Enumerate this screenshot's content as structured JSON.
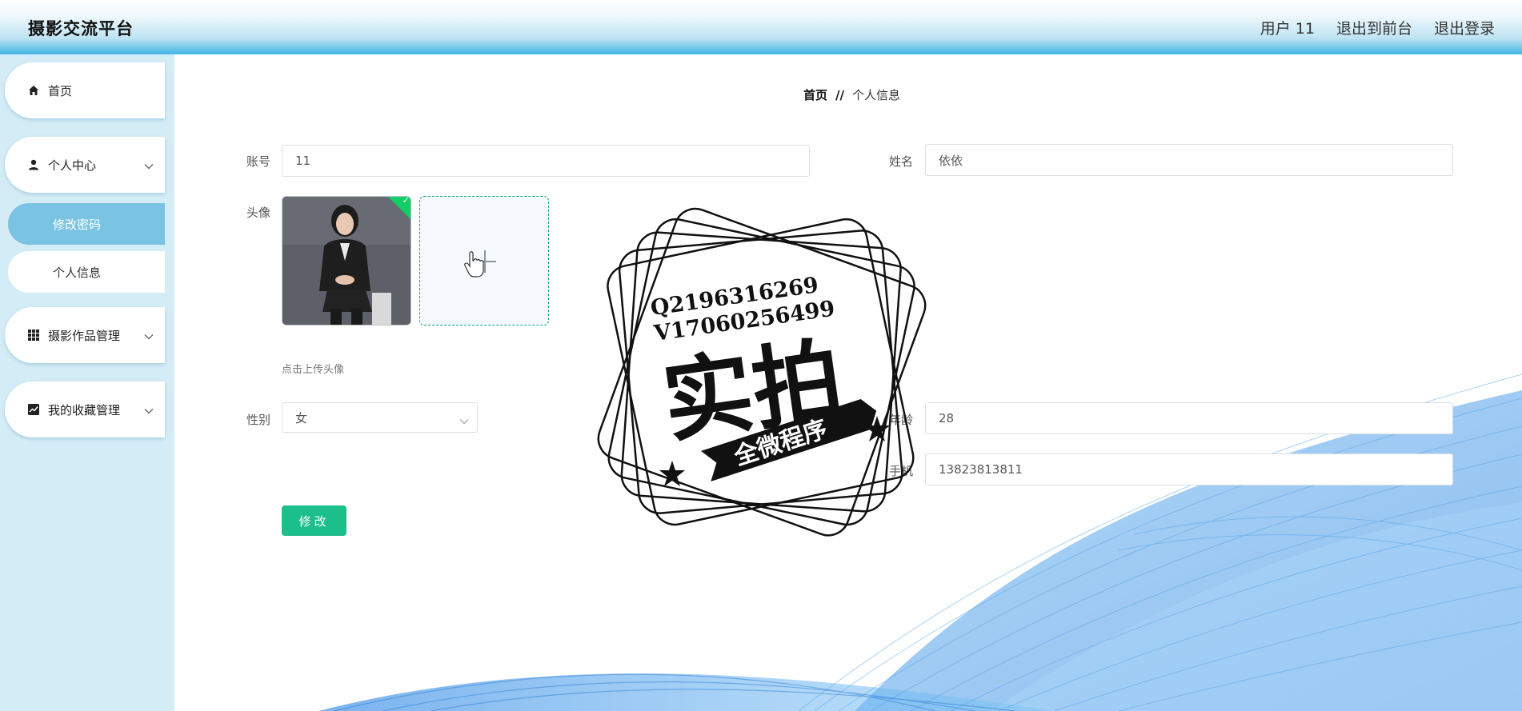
{
  "header": {
    "app_title": "摄影交流平台",
    "user_label": "用户 11",
    "back_to_front": "退出到前台",
    "logout": "退出登录"
  },
  "sidebar": {
    "items": [
      {
        "label": "首页",
        "icon": "home-icon"
      },
      {
        "label": "个人中心",
        "icon": "user-icon"
      },
      {
        "label": "修改密码"
      },
      {
        "label": "个人信息"
      },
      {
        "label": "摄影作品管理",
        "icon": "grid-icon"
      },
      {
        "label": "我的收藏管理",
        "icon": "chart-icon"
      }
    ],
    "active_sub": "修改密码",
    "active_color": "#7bc3e2"
  },
  "breadcrumb": {
    "home": "首页",
    "separator": "//",
    "current": "个人信息"
  },
  "form": {
    "account_label": "账号",
    "account_value": "11",
    "name_label": "姓名",
    "name_value": "依依",
    "avatar_label": "头像",
    "upload_hint": "点击上传头像",
    "gender_label": "性别",
    "gender_value": "女",
    "age_label": "年龄",
    "age_value": "28",
    "phone_label": "手机",
    "phone_value": "13823813811",
    "submit_label": "修改",
    "submit_color": "#1cbf8a"
  },
  "watermark": {
    "line1": "Q2196316269",
    "line2": "V17060256499",
    "main_text": "实拍",
    "ribbon_text": "全微程序"
  }
}
